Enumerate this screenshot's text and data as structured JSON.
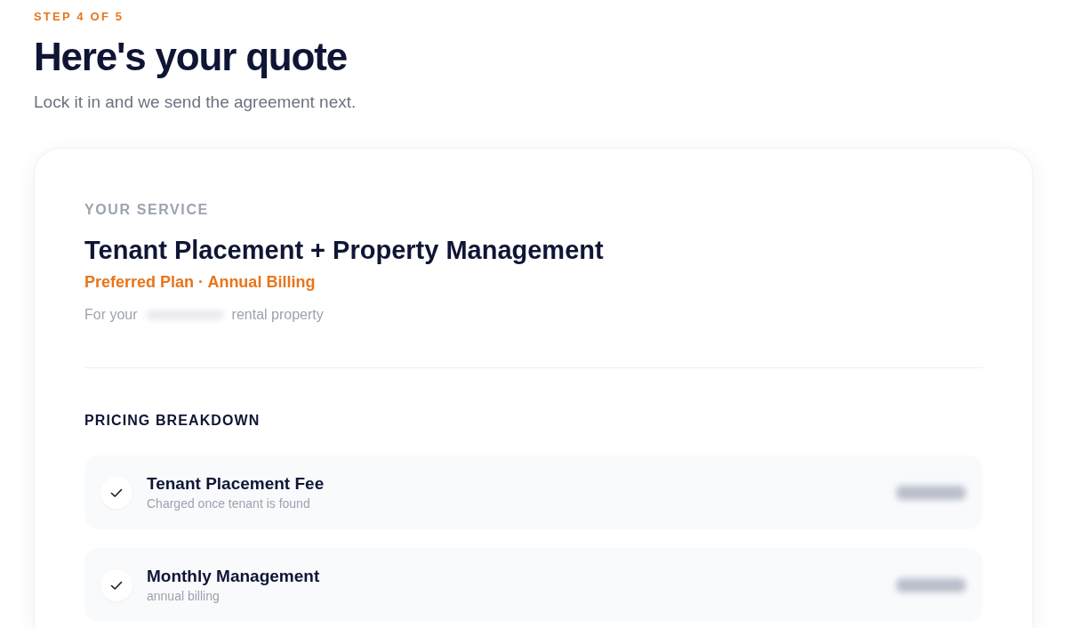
{
  "step_label": "STEP 4 OF 5",
  "title": "Here's your quote",
  "subtitle": "Lock it in and we send the agreement next.",
  "service": {
    "section_label": "YOUR SERVICE",
    "name": "Tenant Placement + Property Management",
    "plan": "Preferred Plan · Annual Billing",
    "location": {
      "prefix": "For your",
      "redacted": true,
      "suffix": "rental property"
    }
  },
  "pricing": {
    "heading": "PRICING BREAKDOWN",
    "items": [
      {
        "name": "Tenant Placement Fee",
        "note": "Charged once tenant is found",
        "included": true,
        "price_redacted": true
      },
      {
        "name": "Monthly Management",
        "note": "annual billing",
        "included": true,
        "price_redacted": true
      }
    ]
  }
}
